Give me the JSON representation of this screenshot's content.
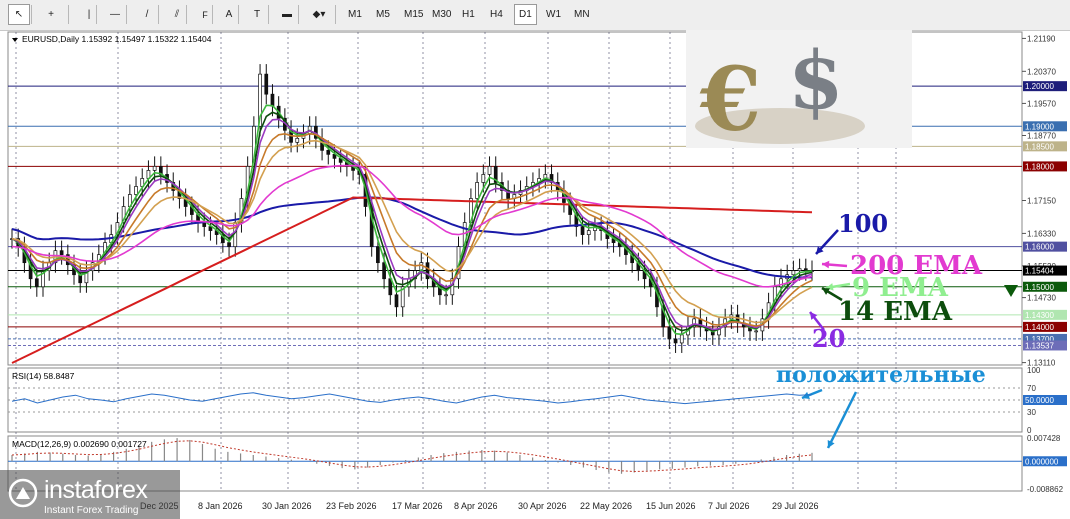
{
  "toolbar": {
    "tools": [
      "cursor-icon",
      "crosshair-icon",
      "vertical-line-icon",
      "horizontal-line-icon",
      "trendline-icon",
      "channel-icon",
      "fibonacci-icon",
      "text-icon",
      "label-icon",
      "rectangle-icon",
      "shapes-menu-icon"
    ],
    "timeframes": [
      "M1",
      "M5",
      "M15",
      "M30",
      "H1",
      "H4",
      "D1",
      "W1",
      "MN"
    ],
    "active_timeframe": "D1"
  },
  "chart_data": {
    "type": "line",
    "symbol_header": "EURUSD,Daily  1.15392 1.15497 1.15322 1.15404",
    "price_axis": {
      "range": [
        1.1305,
        1.2135
      ],
      "ticks": [
        "1.21190",
        "1.20370",
        "1.19570",
        "1.18770",
        "1.17150",
        "1.16330",
        "1.15520",
        "1.14730",
        "1.13110"
      ],
      "levels": [
        {
          "value": 1.2,
          "label": "1.20000",
          "color": "#1e1e7a"
        },
        {
          "value": 1.19,
          "label": "1.19000",
          "color": "#3a6fb0"
        },
        {
          "value": 1.185,
          "label": "1.18500",
          "color": "#bdb38a"
        },
        {
          "value": 1.18,
          "label": "1.18000",
          "color": "#8b0000"
        },
        {
          "value": 1.16,
          "label": "1.16000",
          "color": "#5050a0"
        },
        {
          "value": 1.15404,
          "label": "1.15404",
          "color": "#000000"
        },
        {
          "value": 1.15,
          "label": "1.15000",
          "color": "#0b5a0b"
        },
        {
          "value": 1.143,
          "label": "1.14300",
          "color": "#b0e6b0"
        },
        {
          "value": 1.14,
          "label": "1.14000",
          "color": "#8b0000"
        },
        {
          "value": 1.137,
          "label": "1.13700",
          "color": "#4a6fb0"
        },
        {
          "value": 1.13537,
          "label": "1.13537",
          "color": "#6d6db8"
        }
      ]
    },
    "date_labels": [
      "8 Jan 2026",
      "30 Jan 2026",
      "23 Feb 2026",
      "17 Mar 2026",
      "8 Apr 2026",
      "30 Apr 2026",
      "22 May 2026",
      "15 Jun 2026",
      "7 Jul 2026",
      "29 Jul 2026"
    ],
    "date_label_partial": "Dec 2025",
    "ohlc_close_approx": [
      1.162,
      1.16,
      1.156,
      1.152,
      1.15,
      1.154,
      1.156,
      1.159,
      1.158,
      1.1555,
      1.153,
      1.151,
      1.154,
      1.156,
      1.158,
      1.161,
      1.163,
      1.166,
      1.17,
      1.173,
      1.175,
      1.177,
      1.179,
      1.18,
      1.178,
      1.176,
      1.174,
      1.172,
      1.17,
      1.168,
      1.166,
      1.165,
      1.164,
      1.163,
      1.161,
      1.16,
      1.166,
      1.172,
      1.18,
      1.19,
      1.203,
      1.198,
      1.195,
      1.192,
      1.189,
      1.186,
      1.187,
      1.188,
      1.19,
      1.187,
      1.184,
      1.183,
      1.182,
      1.181,
      1.18,
      1.179,
      1.178,
      1.17,
      1.16,
      1.156,
      1.152,
      1.148,
      1.145,
      1.15,
      1.152,
      1.154,
      1.156,
      1.152,
      1.15,
      1.148,
      1.148,
      1.152,
      1.16,
      1.166,
      1.172,
      1.176,
      1.178,
      1.18,
      1.176,
      1.174,
      1.172,
      1.173,
      1.174,
      1.175,
      1.176,
      1.177,
      1.178,
      1.176,
      1.174,
      1.171,
      1.168,
      1.165,
      1.163,
      1.164,
      1.165,
      1.164,
      1.162,
      1.161,
      1.16,
      1.158,
      1.156,
      1.154,
      1.152,
      1.15,
      1.145,
      1.14,
      1.137,
      1.136,
      1.138,
      1.14,
      1.142,
      1.14,
      1.139,
      1.138,
      1.14,
      1.142,
      1.143,
      1.141,
      1.14,
      1.139,
      1.139,
      1.142,
      1.146,
      1.15,
      1.152,
      1.153,
      1.154,
      1.1545,
      1.154,
      1.15404
    ],
    "indicators_main": [
      {
        "name": "100",
        "role": "sma100",
        "color": "#1a1aa8"
      },
      {
        "name": "200 EMA",
        "role": "ema200",
        "color": "#d61e1e"
      },
      {
        "name": "9 EMA",
        "role": "ema9",
        "color": "#3cb83c"
      },
      {
        "name": "14 EMA",
        "role": "ema14",
        "color": "#0d4d0d"
      },
      {
        "name": "20",
        "role": "ema20",
        "color": "#9a3ac0"
      },
      {
        "name": "",
        "role": "ema50",
        "color": "#c77a2a"
      },
      {
        "name": "",
        "role": "ema55",
        "color": "#d3a050"
      },
      {
        "name": "",
        "role": "pink",
        "color": "#e23ad0"
      }
    ],
    "annotations": [
      {
        "text": "100",
        "color": "#1a1aa8"
      },
      {
        "text": "200 EMA",
        "color": "#e23ad0"
      },
      {
        "text": "9 EMA",
        "color": "#90ee90"
      },
      {
        "text": "14 EMA",
        "color": "#0d4d0d"
      },
      {
        "text": "20",
        "color": "#8a2be2"
      },
      {
        "text": "положительные",
        "color": "#1a8fd6"
      }
    ],
    "rsi": {
      "label": "RSI(14) 58.8487",
      "ticks": [
        "100",
        "70",
        "50.0000",
        "30",
        "0"
      ],
      "range": [
        0,
        100
      ],
      "values": [
        48,
        52,
        45,
        50,
        55,
        58,
        52,
        50,
        47,
        52,
        56,
        60,
        58,
        54,
        50,
        48,
        52,
        56,
        60,
        62,
        58,
        55,
        52,
        54,
        57,
        60,
        56,
        52,
        48,
        46,
        50,
        53,
        55,
        52,
        48,
        45,
        50,
        55,
        58,
        54,
        52,
        50,
        48,
        45,
        47,
        50,
        52,
        55,
        58,
        54,
        50,
        48,
        46,
        44,
        46,
        48,
        50,
        52,
        54,
        56,
        58,
        60,
        58,
        59
      ]
    },
    "macd": {
      "label": "MACD(12,26,9) 0.002690 0.001727",
      "ticks": [
        "0.007428",
        "0.000000",
        "-0.008862"
      ],
      "range": [
        -0.008862,
        0.007428
      ],
      "histogram": [
        0.002,
        0.0025,
        0.003,
        0.0028,
        0.0024,
        0.002,
        0.0018,
        0.0022,
        0.003,
        0.004,
        0.005,
        0.0062,
        0.007,
        0.0074,
        0.0068,
        0.0055,
        0.004,
        0.003,
        0.0025,
        0.002,
        0.0015,
        0.001,
        0.0005,
        0.0,
        -0.0008,
        -0.0015,
        -0.0022,
        -0.0026,
        -0.002,
        -0.0012,
        -0.0004,
        0.0004,
        0.0012,
        0.002,
        0.0026,
        0.003,
        0.0034,
        0.0036,
        0.0034,
        0.0028,
        0.002,
        0.0012,
        0.0004,
        -0.0004,
        -0.0012,
        -0.002,
        -0.0028,
        -0.0036,
        -0.004,
        -0.0036,
        -0.003,
        -0.0026,
        -0.0024,
        -0.002,
        -0.0016,
        -0.0014,
        -0.0012,
        -0.0008,
        -0.0002,
        0.0006,
        0.0014,
        0.002,
        0.0024,
        0.0027
      ]
    }
  },
  "logo": {
    "brand": "instaforex",
    "tagline": "Instant Forex Trading"
  }
}
